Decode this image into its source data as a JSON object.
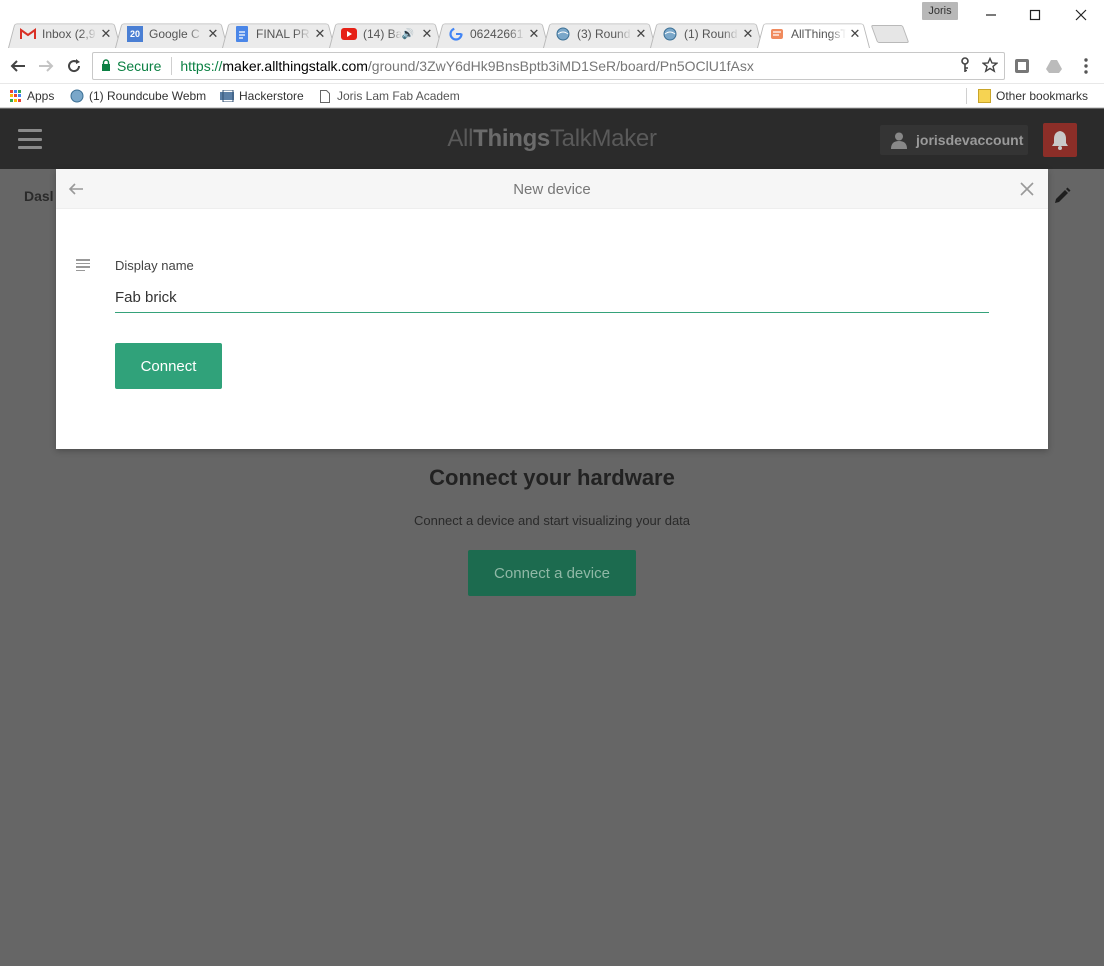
{
  "browser": {
    "profile_name": "Joris",
    "tabs": [
      {
        "title": "Inbox (2,9",
        "favicon": "gmail-icon"
      },
      {
        "title": "Google C",
        "favicon": "calendar-icon",
        "badge": "20"
      },
      {
        "title": "FINAL PR",
        "favicon": "docs-icon"
      },
      {
        "title": "(14) Ba",
        "favicon": "youtube-icon"
      },
      {
        "title": "06242661",
        "favicon": "google-icon"
      },
      {
        "title": "(3) Round",
        "favicon": "roundcube-icon"
      },
      {
        "title": "(1) Round",
        "favicon": "roundcube-icon"
      },
      {
        "title": "AllThingsT",
        "favicon": "allthingstalk-icon"
      }
    ],
    "address": {
      "secure_label": "Secure",
      "scheme": "https://",
      "host": "maker.allthingstalk.com",
      "path": "/ground/3ZwY6dHk9BnsBptb3iMD1SeR/board/Pn5OClU1fAsx"
    },
    "bookmarks": [
      {
        "label": "Apps"
      },
      {
        "label": "(1) Roundcube Webm"
      },
      {
        "label": "Hackerstore"
      },
      {
        "label": "Joris Lam Fab Academ"
      }
    ],
    "other_bookmarks": "Other bookmarks"
  },
  "app": {
    "logo_prefix": "All",
    "logo_bold": "Things",
    "logo_suffix": "TalkMaker",
    "username": "jorisdevaccount",
    "dashboard_label": "Dasl"
  },
  "modal": {
    "title": "New device",
    "field_label": "Display name",
    "field_value": "Fab brick",
    "connect_label": "Connect"
  },
  "empty_state": {
    "title": "Connect your hardware",
    "subtitle": "Connect a device and start visualizing your data",
    "button_label": "Connect a device"
  },
  "colors": {
    "accent_green": "#30a27a",
    "header_dark": "#2b2b2b",
    "overlay_gray": "#666666",
    "notification_red": "#8c2e28"
  }
}
